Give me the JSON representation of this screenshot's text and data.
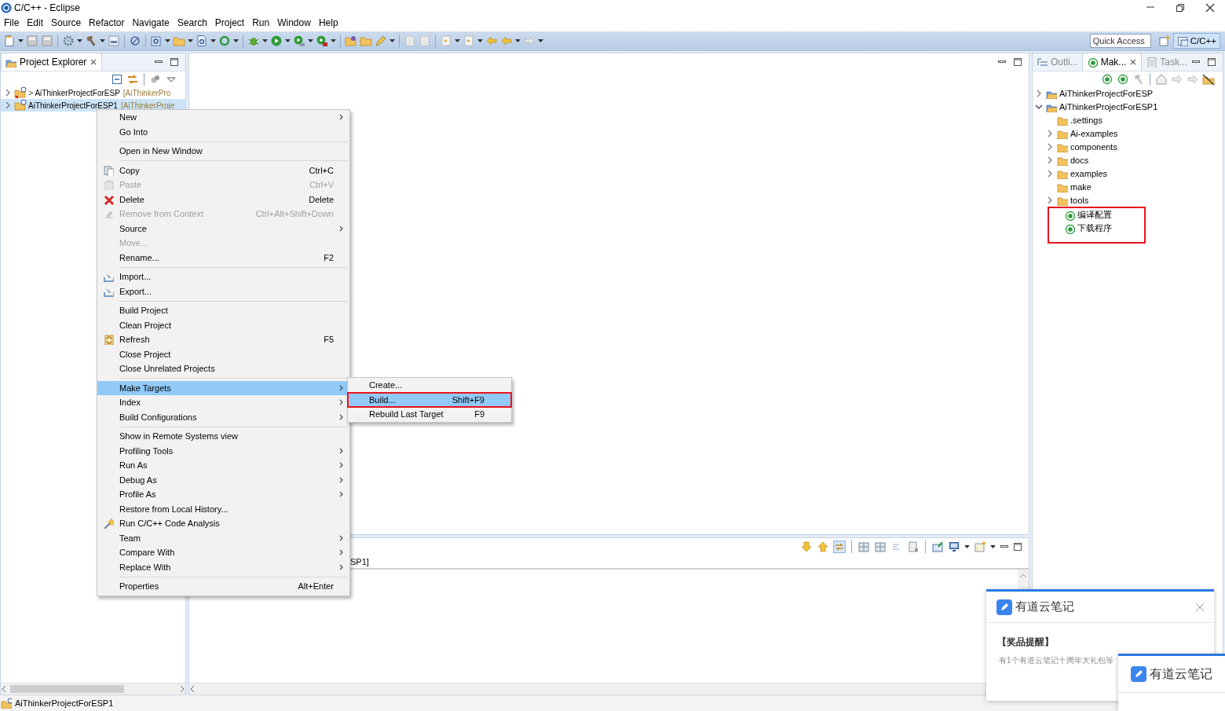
{
  "window": {
    "title": "C/C++ - Eclipse"
  },
  "menu_bar": [
    {
      "label": "File"
    },
    {
      "label": "Edit"
    },
    {
      "label": "Source"
    },
    {
      "label": "Refactor"
    },
    {
      "label": "Navigate"
    },
    {
      "label": "Search"
    },
    {
      "label": "Project"
    },
    {
      "label": "Run"
    },
    {
      "label": "Window"
    },
    {
      "label": "Help"
    }
  ],
  "toolbar": {
    "quick_access": {
      "placeholder": "Quick Access"
    },
    "perspective": {
      "label": "C/C++",
      "selected": true
    }
  },
  "project_explorer": {
    "tab": {
      "label": "Project Explorer",
      "selected": true
    },
    "tree": [
      {
        "label": "AiThinkerProjectForESP",
        "prefix": ">",
        "decoration": "[AiThinkerPro",
        "selected": false,
        "expanded": false
      },
      {
        "label": "AiThinkerProjectForESP1",
        "decoration": "[AiThinkerProje",
        "selected": true,
        "expanded": false
      }
    ]
  },
  "right_panel": {
    "tabs": [
      {
        "label": "Outli...",
        "selected": false
      },
      {
        "label": "Mak...",
        "selected": true
      },
      {
        "label": "Task...",
        "selected": false
      }
    ],
    "tree": [
      {
        "kind": "project",
        "label": "AiThinkerProjectForESP",
        "expandable": true,
        "expanded": false,
        "highlighted": false
      },
      {
        "kind": "project",
        "label": "AiThinkerProjectForESP1",
        "expandable": true,
        "expanded": true,
        "highlighted": false,
        "children": [
          {
            "kind": "folder",
            "label": ".settings",
            "expandable": false,
            "highlighted": false
          },
          {
            "kind": "folder",
            "label": "Ai-examples",
            "expandable": true,
            "expanded": false,
            "highlighted": false
          },
          {
            "kind": "folder",
            "label": "components",
            "expandable": true,
            "expanded": false,
            "highlighted": false
          },
          {
            "kind": "folder",
            "label": "docs",
            "expandable": true,
            "expanded": false,
            "highlighted": false
          },
          {
            "kind": "folder",
            "label": "examples",
            "expandable": true,
            "expanded": false,
            "highlighted": false
          },
          {
            "kind": "folder",
            "label": "make",
            "expandable": false,
            "highlighted": false
          },
          {
            "kind": "folder",
            "label": "tools",
            "expandable": true,
            "expanded": false,
            "highlighted": false
          },
          {
            "kind": "target",
            "label": "编译配置",
            "expandable": false,
            "highlighted": true
          },
          {
            "kind": "target",
            "label": "下载程序",
            "expandable": false,
            "highlighted": true
          }
        ]
      }
    ]
  },
  "console": {
    "title": "SP1]"
  },
  "context_menu": {
    "items": [
      {
        "kind": "item",
        "label": "New",
        "submenu": true,
        "disabled": false,
        "selected": false
      },
      {
        "kind": "item",
        "label": "Go Into",
        "submenu": false,
        "disabled": false,
        "selected": false
      },
      {
        "kind": "separator"
      },
      {
        "kind": "item",
        "label": "Open in New Window",
        "submenu": false,
        "disabled": false,
        "selected": false
      },
      {
        "kind": "separator"
      },
      {
        "kind": "item",
        "label": "Copy",
        "shortcut": "Ctrl+C",
        "submenu": false,
        "disabled": false,
        "selected": false
      },
      {
        "kind": "item",
        "label": "Paste",
        "shortcut": "Ctrl+V",
        "submenu": false,
        "disabled": true,
        "selected": false
      },
      {
        "kind": "item",
        "label": "Delete",
        "shortcut": "Delete",
        "submenu": false,
        "disabled": false,
        "selected": false
      },
      {
        "kind": "item",
        "label": "Remove from Context",
        "shortcut": "Ctrl+Alt+Shift+Down",
        "submenu": false,
        "disabled": true,
        "selected": false
      },
      {
        "kind": "item",
        "label": "Source",
        "submenu": true,
        "disabled": false,
        "selected": false
      },
      {
        "kind": "item",
        "label": "Move...",
        "submenu": false,
        "disabled": true,
        "selected": false
      },
      {
        "kind": "item",
        "label": "Rename...",
        "shortcut": "F2",
        "submenu": false,
        "disabled": false,
        "selected": false
      },
      {
        "kind": "separator"
      },
      {
        "kind": "item",
        "label": "Import...",
        "submenu": false,
        "disabled": false,
        "selected": false
      },
      {
        "kind": "item",
        "label": "Export...",
        "submenu": false,
        "disabled": false,
        "selected": false
      },
      {
        "kind": "separator"
      },
      {
        "kind": "item",
        "label": "Build Project",
        "submenu": false,
        "disabled": false,
        "selected": false
      },
      {
        "kind": "item",
        "label": "Clean Project",
        "submenu": false,
        "disabled": false,
        "selected": false
      },
      {
        "kind": "item",
        "label": "Refresh",
        "shortcut": "F5",
        "submenu": false,
        "disabled": false,
        "selected": false
      },
      {
        "kind": "item",
        "label": "Close Project",
        "submenu": false,
        "disabled": false,
        "selected": false
      },
      {
        "kind": "item",
        "label": "Close Unrelated Projects",
        "submenu": false,
        "disabled": false,
        "selected": false
      },
      {
        "kind": "separator"
      },
      {
        "kind": "item",
        "label": "Make Targets",
        "submenu": true,
        "disabled": false,
        "selected": true
      },
      {
        "kind": "item",
        "label": "Index",
        "submenu": true,
        "disabled": false,
        "selected": false
      },
      {
        "kind": "item",
        "label": "Build Configurations",
        "submenu": true,
        "disabled": false,
        "selected": false
      },
      {
        "kind": "separator"
      },
      {
        "kind": "item",
        "label": "Show in Remote Systems view",
        "submenu": false,
        "disabled": false,
        "selected": false
      },
      {
        "kind": "item",
        "label": "Profiling Tools",
        "submenu": true,
        "disabled": false,
        "selected": false
      },
      {
        "kind": "item",
        "label": "Run As",
        "submenu": true,
        "disabled": false,
        "selected": false
      },
      {
        "kind": "item",
        "label": "Debug As",
        "submenu": true,
        "disabled": false,
        "selected": false
      },
      {
        "kind": "item",
        "label": "Profile As",
        "submenu": true,
        "disabled": false,
        "selected": false
      },
      {
        "kind": "item",
        "label": "Restore from Local History...",
        "submenu": false,
        "disabled": false,
        "selected": false
      },
      {
        "kind": "item",
        "label": "Run C/C++ Code Analysis",
        "submenu": false,
        "disabled": false,
        "selected": false
      },
      {
        "kind": "item",
        "label": "Team",
        "submenu": true,
        "disabled": false,
        "selected": false
      },
      {
        "kind": "item",
        "label": "Compare With",
        "submenu": true,
        "disabled": false,
        "selected": false
      },
      {
        "kind": "item",
        "label": "Replace With",
        "submenu": true,
        "disabled": false,
        "selected": false
      },
      {
        "kind": "separator"
      },
      {
        "kind": "item",
        "label": "Properties",
        "shortcut": "Alt+Enter",
        "submenu": false,
        "disabled": false,
        "selected": false
      }
    ]
  },
  "submenu": {
    "items": [
      {
        "kind": "item",
        "label": "Create...",
        "selected": false,
        "highlighted": false
      },
      {
        "kind": "item",
        "label": "Build...",
        "shortcut": "Shift+F9",
        "selected": true,
        "highlighted": true
      },
      {
        "kind": "item",
        "label": "Rebuild Last Target",
        "shortcut": "F9",
        "selected": false,
        "highlighted": false
      }
    ]
  },
  "notifications": [
    {
      "title": "有道云笔记",
      "heading": "【奖品提醒】",
      "body": "有1个有道云笔记十周年大礼包等"
    },
    {
      "title": "有道云笔记"
    }
  ],
  "status_bar": {
    "text": "AiThinkerProjectForESP1"
  }
}
